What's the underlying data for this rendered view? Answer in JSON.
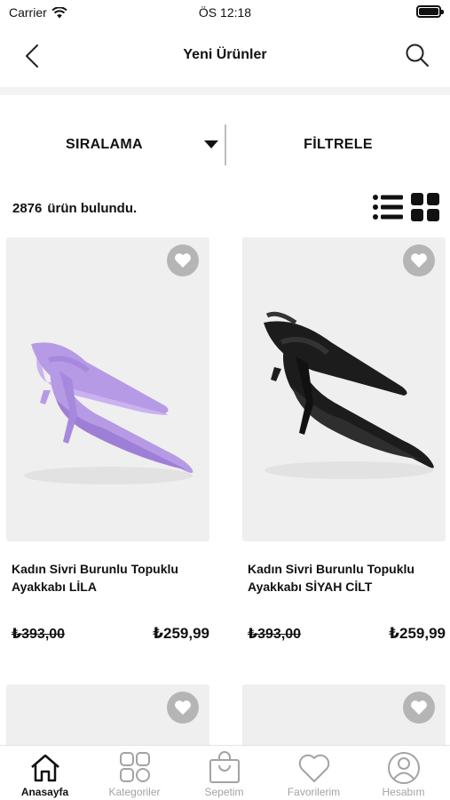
{
  "status_bar": {
    "carrier": "Carrier",
    "time": "ÖS 12:18"
  },
  "nav": {
    "title": "Yeni Ürünler"
  },
  "toolbar": {
    "sort_label": "SIRALAMA",
    "filter_label": "FİLTRELE"
  },
  "results": {
    "count": "2876",
    "text": "ürün bulundu."
  },
  "products": [
    {
      "name": "Kadın Sivri Burunlu Topuklu Ayakkabı LİLA",
      "old_price": "₺393,00",
      "price": "₺259,99",
      "shoe_color": "#b79ae6"
    },
    {
      "name": "Kadın Sivri Burunlu Topuklu Ayakkabı SİYAH CİLT",
      "old_price": "₺393,00",
      "price": "₺259,99",
      "shoe_color": "#1c1c1c"
    }
  ],
  "tabs": [
    {
      "label": "Anasayfa",
      "icon": "home-icon",
      "active": true
    },
    {
      "label": "Kategoriler",
      "icon": "categories-icon",
      "active": false
    },
    {
      "label": "Sepetim",
      "icon": "cart-bag-icon",
      "active": false
    },
    {
      "label": "Favorilerim",
      "icon": "heart-icon",
      "active": false
    },
    {
      "label": "Hesabım",
      "icon": "user-icon",
      "active": false
    }
  ],
  "colors": {
    "accent": "#111111",
    "inactive": "#a3a3a3",
    "card_bg": "#efefef",
    "fav_bg": "#b5b5b5"
  }
}
